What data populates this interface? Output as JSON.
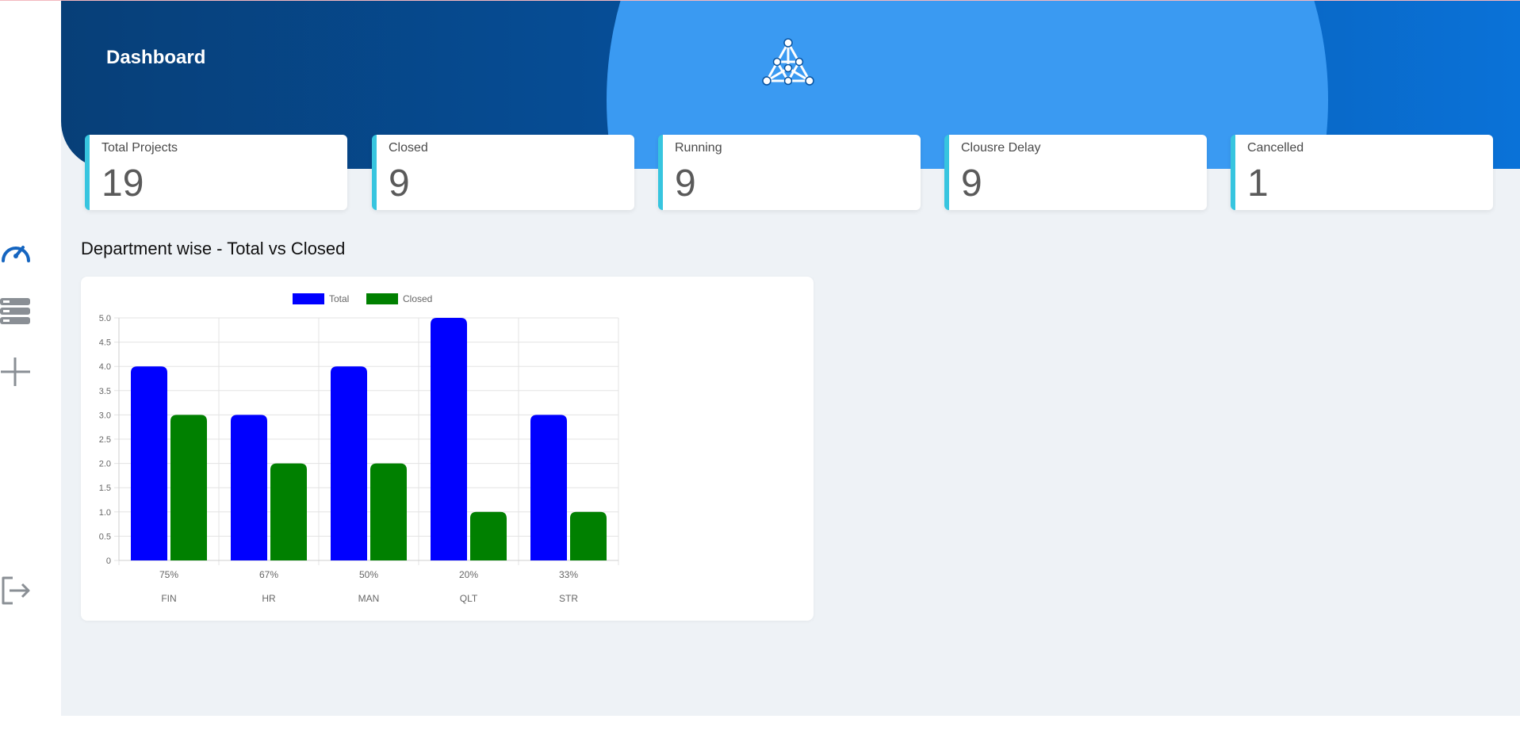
{
  "header": {
    "title": "Dashboard"
  },
  "sidebar": {
    "items": [
      {
        "icon": "speedometer-icon"
      },
      {
        "icon": "server-stack-icon"
      },
      {
        "icon": "plus-icon"
      },
      {
        "icon": "logout-icon"
      }
    ],
    "active_color": "#1565c0",
    "inactive_color": "#8a8f95"
  },
  "kpis": [
    {
      "label": "Total Projects",
      "value": "19"
    },
    {
      "label": "Closed",
      "value": "9"
    },
    {
      "label": "Running",
      "value": "9"
    },
    {
      "label": "Clousre Delay",
      "value": "9"
    },
    {
      "label": "Cancelled",
      "value": "1"
    }
  ],
  "section": {
    "title": "Department wise - Total vs Closed"
  },
  "colors": {
    "accent": "#37c5df",
    "total": "#0000ff",
    "closed": "#008000"
  },
  "chart_data": {
    "type": "bar",
    "categories": [
      "FIN",
      "HR",
      "MAN",
      "QLT",
      "STR"
    ],
    "percent_labels": [
      "75%",
      "67%",
      "50%",
      "20%",
      "33%"
    ],
    "series": [
      {
        "name": "Total",
        "values": [
          4,
          3,
          4,
          5,
          3
        ],
        "color": "#0000ff"
      },
      {
        "name": "Closed",
        "values": [
          3,
          2,
          2,
          1,
          1
        ],
        "color": "#008000"
      }
    ],
    "ylim": [
      0,
      5
    ],
    "yticks": [
      "0",
      "0.5",
      "1.0",
      "1.5",
      "2.0",
      "2.5",
      "3.0",
      "3.5",
      "4.0",
      "4.5",
      "5.0"
    ],
    "grid": true,
    "legend": "top"
  }
}
